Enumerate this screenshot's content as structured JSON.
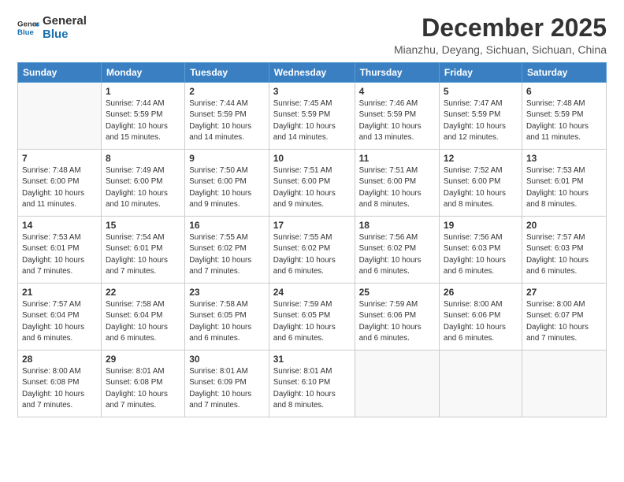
{
  "logo": {
    "line1": "General",
    "line2": "Blue"
  },
  "title": "December 2025",
  "location": "Mianzhu, Deyang, Sichuan, Sichuan, China",
  "weekdays": [
    "Sunday",
    "Monday",
    "Tuesday",
    "Wednesday",
    "Thursday",
    "Friday",
    "Saturday"
  ],
  "weeks": [
    [
      {
        "day": "",
        "info": ""
      },
      {
        "day": "1",
        "info": "Sunrise: 7:44 AM\nSunset: 5:59 PM\nDaylight: 10 hours\nand 15 minutes."
      },
      {
        "day": "2",
        "info": "Sunrise: 7:44 AM\nSunset: 5:59 PM\nDaylight: 10 hours\nand 14 minutes."
      },
      {
        "day": "3",
        "info": "Sunrise: 7:45 AM\nSunset: 5:59 PM\nDaylight: 10 hours\nand 14 minutes."
      },
      {
        "day": "4",
        "info": "Sunrise: 7:46 AM\nSunset: 5:59 PM\nDaylight: 10 hours\nand 13 minutes."
      },
      {
        "day": "5",
        "info": "Sunrise: 7:47 AM\nSunset: 5:59 PM\nDaylight: 10 hours\nand 12 minutes."
      },
      {
        "day": "6",
        "info": "Sunrise: 7:48 AM\nSunset: 5:59 PM\nDaylight: 10 hours\nand 11 minutes."
      }
    ],
    [
      {
        "day": "7",
        "info": "Sunrise: 7:48 AM\nSunset: 6:00 PM\nDaylight: 10 hours\nand 11 minutes."
      },
      {
        "day": "8",
        "info": "Sunrise: 7:49 AM\nSunset: 6:00 PM\nDaylight: 10 hours\nand 10 minutes."
      },
      {
        "day": "9",
        "info": "Sunrise: 7:50 AM\nSunset: 6:00 PM\nDaylight: 10 hours\nand 9 minutes."
      },
      {
        "day": "10",
        "info": "Sunrise: 7:51 AM\nSunset: 6:00 PM\nDaylight: 10 hours\nand 9 minutes."
      },
      {
        "day": "11",
        "info": "Sunrise: 7:51 AM\nSunset: 6:00 PM\nDaylight: 10 hours\nand 8 minutes."
      },
      {
        "day": "12",
        "info": "Sunrise: 7:52 AM\nSunset: 6:00 PM\nDaylight: 10 hours\nand 8 minutes."
      },
      {
        "day": "13",
        "info": "Sunrise: 7:53 AM\nSunset: 6:01 PM\nDaylight: 10 hours\nand 8 minutes."
      }
    ],
    [
      {
        "day": "14",
        "info": "Sunrise: 7:53 AM\nSunset: 6:01 PM\nDaylight: 10 hours\nand 7 minutes."
      },
      {
        "day": "15",
        "info": "Sunrise: 7:54 AM\nSunset: 6:01 PM\nDaylight: 10 hours\nand 7 minutes."
      },
      {
        "day": "16",
        "info": "Sunrise: 7:55 AM\nSunset: 6:02 PM\nDaylight: 10 hours\nand 7 minutes."
      },
      {
        "day": "17",
        "info": "Sunrise: 7:55 AM\nSunset: 6:02 PM\nDaylight: 10 hours\nand 6 minutes."
      },
      {
        "day": "18",
        "info": "Sunrise: 7:56 AM\nSunset: 6:02 PM\nDaylight: 10 hours\nand 6 minutes."
      },
      {
        "day": "19",
        "info": "Sunrise: 7:56 AM\nSunset: 6:03 PM\nDaylight: 10 hours\nand 6 minutes."
      },
      {
        "day": "20",
        "info": "Sunrise: 7:57 AM\nSunset: 6:03 PM\nDaylight: 10 hours\nand 6 minutes."
      }
    ],
    [
      {
        "day": "21",
        "info": "Sunrise: 7:57 AM\nSunset: 6:04 PM\nDaylight: 10 hours\nand 6 minutes."
      },
      {
        "day": "22",
        "info": "Sunrise: 7:58 AM\nSunset: 6:04 PM\nDaylight: 10 hours\nand 6 minutes."
      },
      {
        "day": "23",
        "info": "Sunrise: 7:58 AM\nSunset: 6:05 PM\nDaylight: 10 hours\nand 6 minutes."
      },
      {
        "day": "24",
        "info": "Sunrise: 7:59 AM\nSunset: 6:05 PM\nDaylight: 10 hours\nand 6 minutes."
      },
      {
        "day": "25",
        "info": "Sunrise: 7:59 AM\nSunset: 6:06 PM\nDaylight: 10 hours\nand 6 minutes."
      },
      {
        "day": "26",
        "info": "Sunrise: 8:00 AM\nSunset: 6:06 PM\nDaylight: 10 hours\nand 6 minutes."
      },
      {
        "day": "27",
        "info": "Sunrise: 8:00 AM\nSunset: 6:07 PM\nDaylight: 10 hours\nand 7 minutes."
      }
    ],
    [
      {
        "day": "28",
        "info": "Sunrise: 8:00 AM\nSunset: 6:08 PM\nDaylight: 10 hours\nand 7 minutes."
      },
      {
        "day": "29",
        "info": "Sunrise: 8:01 AM\nSunset: 6:08 PM\nDaylight: 10 hours\nand 7 minutes."
      },
      {
        "day": "30",
        "info": "Sunrise: 8:01 AM\nSunset: 6:09 PM\nDaylight: 10 hours\nand 7 minutes."
      },
      {
        "day": "31",
        "info": "Sunrise: 8:01 AM\nSunset: 6:10 PM\nDaylight: 10 hours\nand 8 minutes."
      },
      {
        "day": "",
        "info": ""
      },
      {
        "day": "",
        "info": ""
      },
      {
        "day": "",
        "info": ""
      }
    ]
  ]
}
